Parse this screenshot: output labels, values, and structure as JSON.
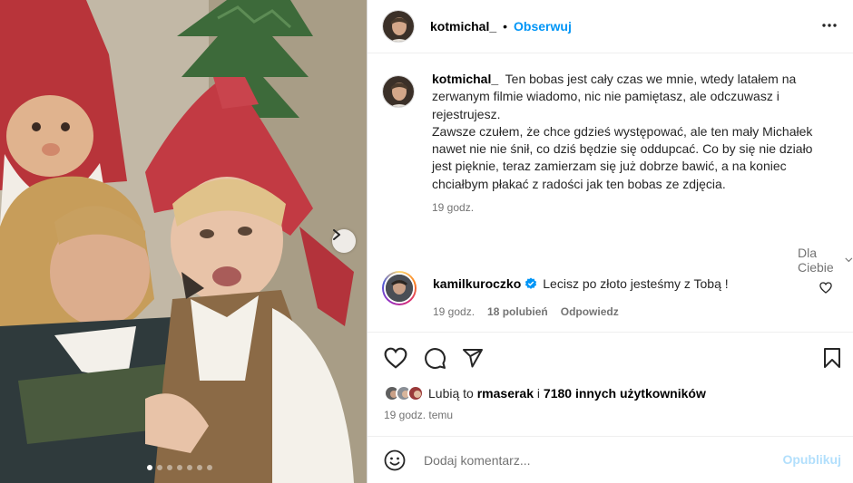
{
  "post": {
    "username": "kotmichal_",
    "separator": "•",
    "follow_label": "Obserwuj",
    "more_icon": "more-horizontal-icon",
    "image_alt_icon": "photo-image",
    "carousel_dots": 7,
    "carousel_active": 1
  },
  "caption": {
    "username": "kotmichal_",
    "text": "Ten bobas jest cały czas we mnie, wtedy latałem na zerwanym filmie wiadomo, nic nie pamiętasz, ale odczuwasz i rejestrujesz.",
    "text2": "Zawsze czułem, że chce gdzieś występować, ale ten mały Michałek nawet nie nie śnił, co dziś będzie się oddupcać. Co by się nie działo jest pięknie, teraz zamierzam się już dobrze bawić, a na koniec chciałbym płakać z radości jak ten bobas ze zdjęcia.",
    "time": "19 godz."
  },
  "filter": {
    "label": "Dla Ciebie"
  },
  "comment": {
    "username": "kamilkuroczko",
    "text": "Lecisz po złoto jesteśmy z Tobą !",
    "time": "19 godz.",
    "likes": "18 polubień",
    "reply": "Odpowiedz"
  },
  "likes": {
    "prefix": "Lubią to",
    "user": "rmaserak",
    "mid": "i",
    "others": "7180 innych użytkowników",
    "ago": "19 godz. temu"
  },
  "add_comment": {
    "placeholder": "Dodaj komentarz...",
    "publish": "Opublikuj"
  },
  "colors": {
    "accent": "#0095f6",
    "publish_disabled": "#b2dffc",
    "muted": "#737373"
  }
}
